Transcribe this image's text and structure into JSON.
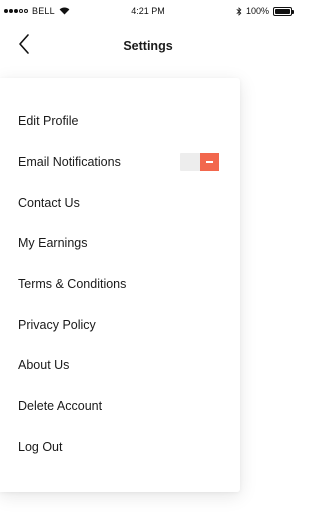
{
  "status_bar": {
    "carrier": "BELL",
    "time": "4:21 PM",
    "battery": "100%"
  },
  "nav": {
    "title": "Settings",
    "back_icon": "chevron-left-icon"
  },
  "settings": {
    "items": [
      {
        "label": "Edit Profile"
      },
      {
        "label": "Email Notifications",
        "toggle": {
          "on": true,
          "accent": "#f2674d"
        }
      },
      {
        "label": "Contact Us"
      },
      {
        "label": "My Earnings"
      },
      {
        "label": "Terms & Conditions"
      },
      {
        "label": "Privacy Policy"
      },
      {
        "label": "About Us"
      },
      {
        "label": "Delete Account"
      },
      {
        "label": "Log Out"
      }
    ]
  }
}
